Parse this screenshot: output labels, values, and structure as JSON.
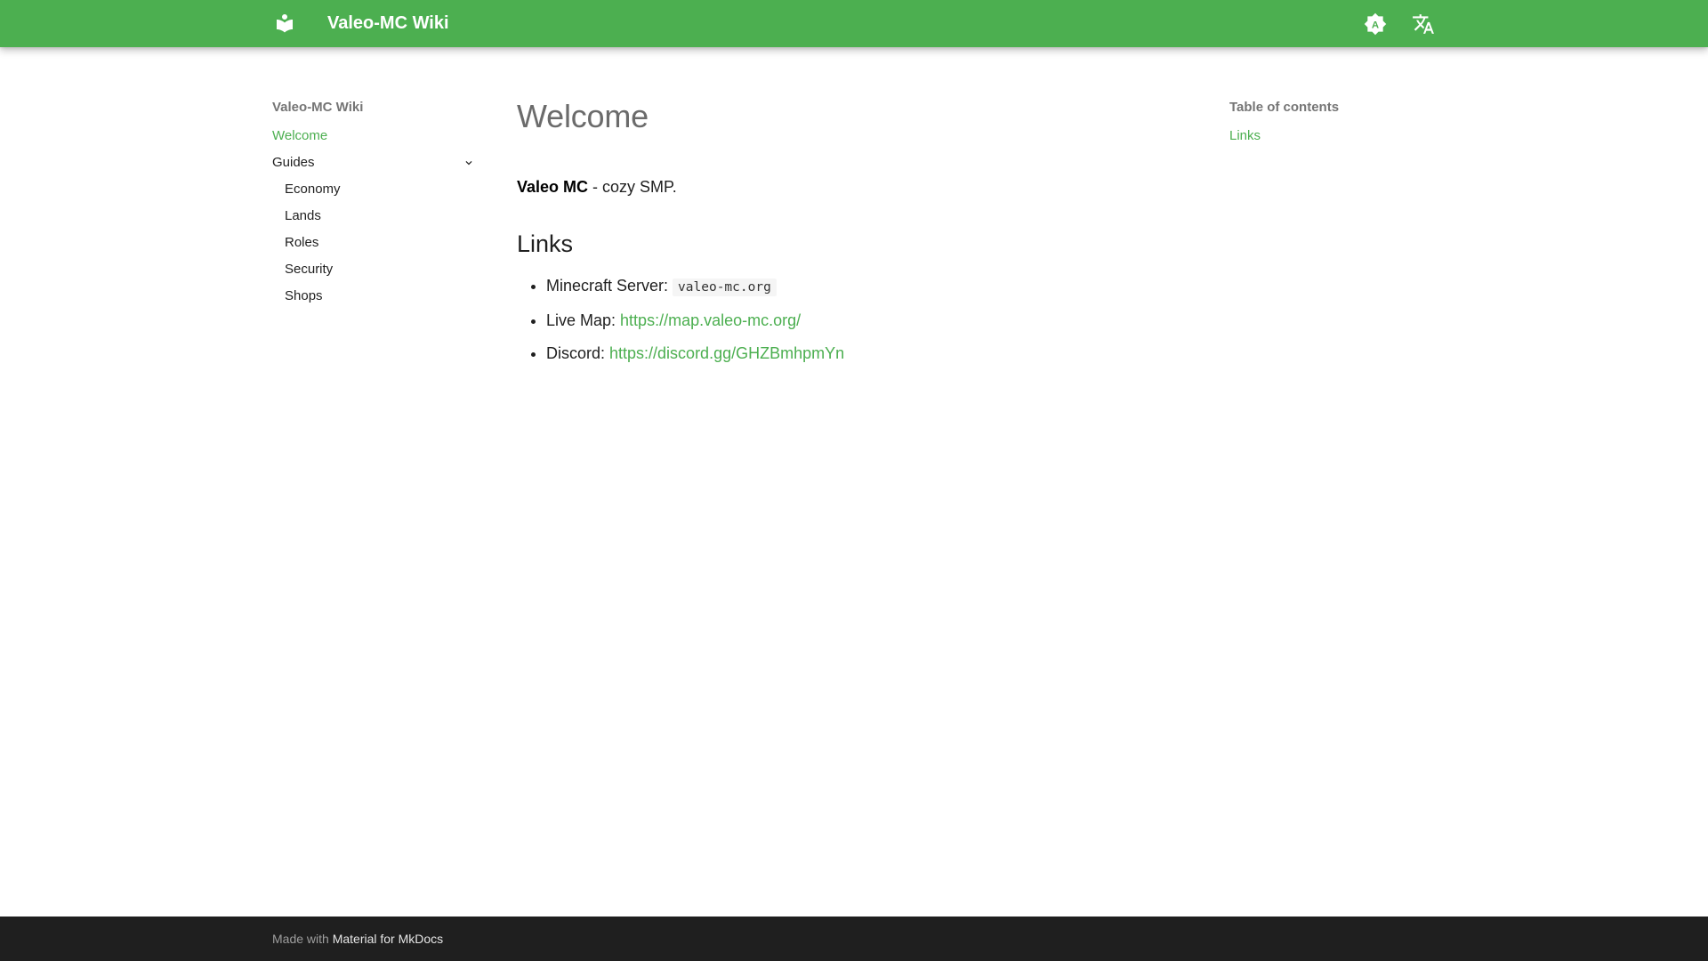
{
  "colors": {
    "primary": "#4caf50",
    "footer_bg": "#1f1f1f",
    "nav_title": "#757575"
  },
  "header": {
    "logo_icon": "book-open-icon",
    "site_title": "Valeo-MC Wiki",
    "theme_icon": "brightness-auto-icon",
    "language_icon": "translate-icon"
  },
  "nav": {
    "title": "Valeo-MC Wiki",
    "items": [
      {
        "label": "Welcome",
        "active": true
      },
      {
        "label": "Guides",
        "expanded": true,
        "children": [
          {
            "label": "Economy"
          },
          {
            "label": "Lands"
          },
          {
            "label": "Roles"
          },
          {
            "label": "Security"
          },
          {
            "label": "Shops"
          }
        ]
      }
    ]
  },
  "main": {
    "title": "Welcome",
    "intro_bold": "Valeo MC",
    "intro_rest": " - cozy SMP.",
    "links_heading": "Links",
    "links": [
      {
        "label": "Minecraft Server: ",
        "code": "valeo-mc.org"
      },
      {
        "label": "Live Map: ",
        "url": "https://map.valeo-mc.org/"
      },
      {
        "label": "Discord: ",
        "url": "https://discord.gg/GHZBmhpmYn"
      }
    ]
  },
  "toc": {
    "title": "Table of contents",
    "items": [
      "Links"
    ]
  },
  "footer": {
    "made_with": "Made with ",
    "link_text": "Material for MkDocs"
  }
}
